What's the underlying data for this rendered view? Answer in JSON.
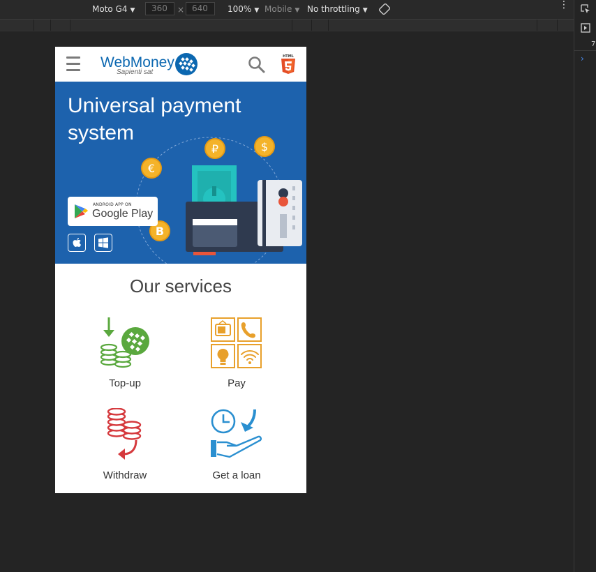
{
  "devtools": {
    "device": "Moto G4",
    "width": "360",
    "times": "×",
    "height": "640",
    "zoom": "100%",
    "mode": "Mobile",
    "throttle": "No throttling",
    "side_number": "7"
  },
  "header": {
    "brand": "WebMoney",
    "tagline": "Sapienti sat",
    "html5_label": "HTML"
  },
  "hero": {
    "title": "Universal payment system",
    "gplay_small": "ANDROID APP ON",
    "gplay_big": "Google Play",
    "coins": [
      "₽",
      "$",
      "€",
      "B"
    ]
  },
  "services": {
    "title": "Our services",
    "items": [
      {
        "label": "Top-up"
      },
      {
        "label": "Pay"
      },
      {
        "label": "Withdraw"
      },
      {
        "label": "Get a loan"
      }
    ]
  },
  "colors": {
    "brand_blue": "#0b67b0",
    "hero_bg": "#1d62ad",
    "coin": "#f4b32a",
    "topup_green": "#5aa83e",
    "pay_orange": "#e8a02b",
    "withdraw_red": "#d5393d",
    "loan_blue": "#2a8fd0"
  }
}
